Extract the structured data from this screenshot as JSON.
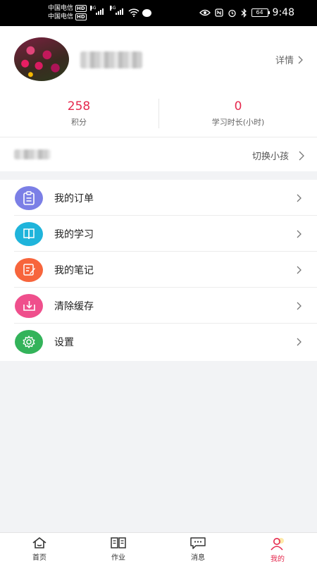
{
  "status_bar": {
    "carrier1": "中国电信",
    "carrier2": "中国电信",
    "hd": "HD",
    "net1": "4G",
    "net2": "4G",
    "battery": "64",
    "time": "9:48"
  },
  "profile": {
    "detail_label": "详情",
    "stats": [
      {
        "value": "258",
        "label": "积分"
      },
      {
        "value": "0",
        "label": "学习时长(小时)"
      }
    ],
    "switch_child_label": "切换小孩"
  },
  "menu": [
    {
      "label": "我的订单",
      "icon": "order-icon",
      "color": "#7b7fe6"
    },
    {
      "label": "我的学习",
      "icon": "book-icon",
      "color": "#1fb4db"
    },
    {
      "label": "我的笔记",
      "icon": "note-icon",
      "color": "#f7653c"
    },
    {
      "label": "清除缓存",
      "icon": "download-icon",
      "color": "#ef4f8c"
    },
    {
      "label": "设置",
      "icon": "gear-icon",
      "color": "#33b35a"
    }
  ],
  "tabs": [
    {
      "label": "首页",
      "icon": "home-icon"
    },
    {
      "label": "作业",
      "icon": "homework-icon"
    },
    {
      "label": "消息",
      "icon": "message-icon"
    },
    {
      "label": "我的",
      "icon": "profile-icon",
      "active": true
    }
  ],
  "colors": {
    "accent": "#e5294e",
    "background": "#f2f3f5"
  }
}
